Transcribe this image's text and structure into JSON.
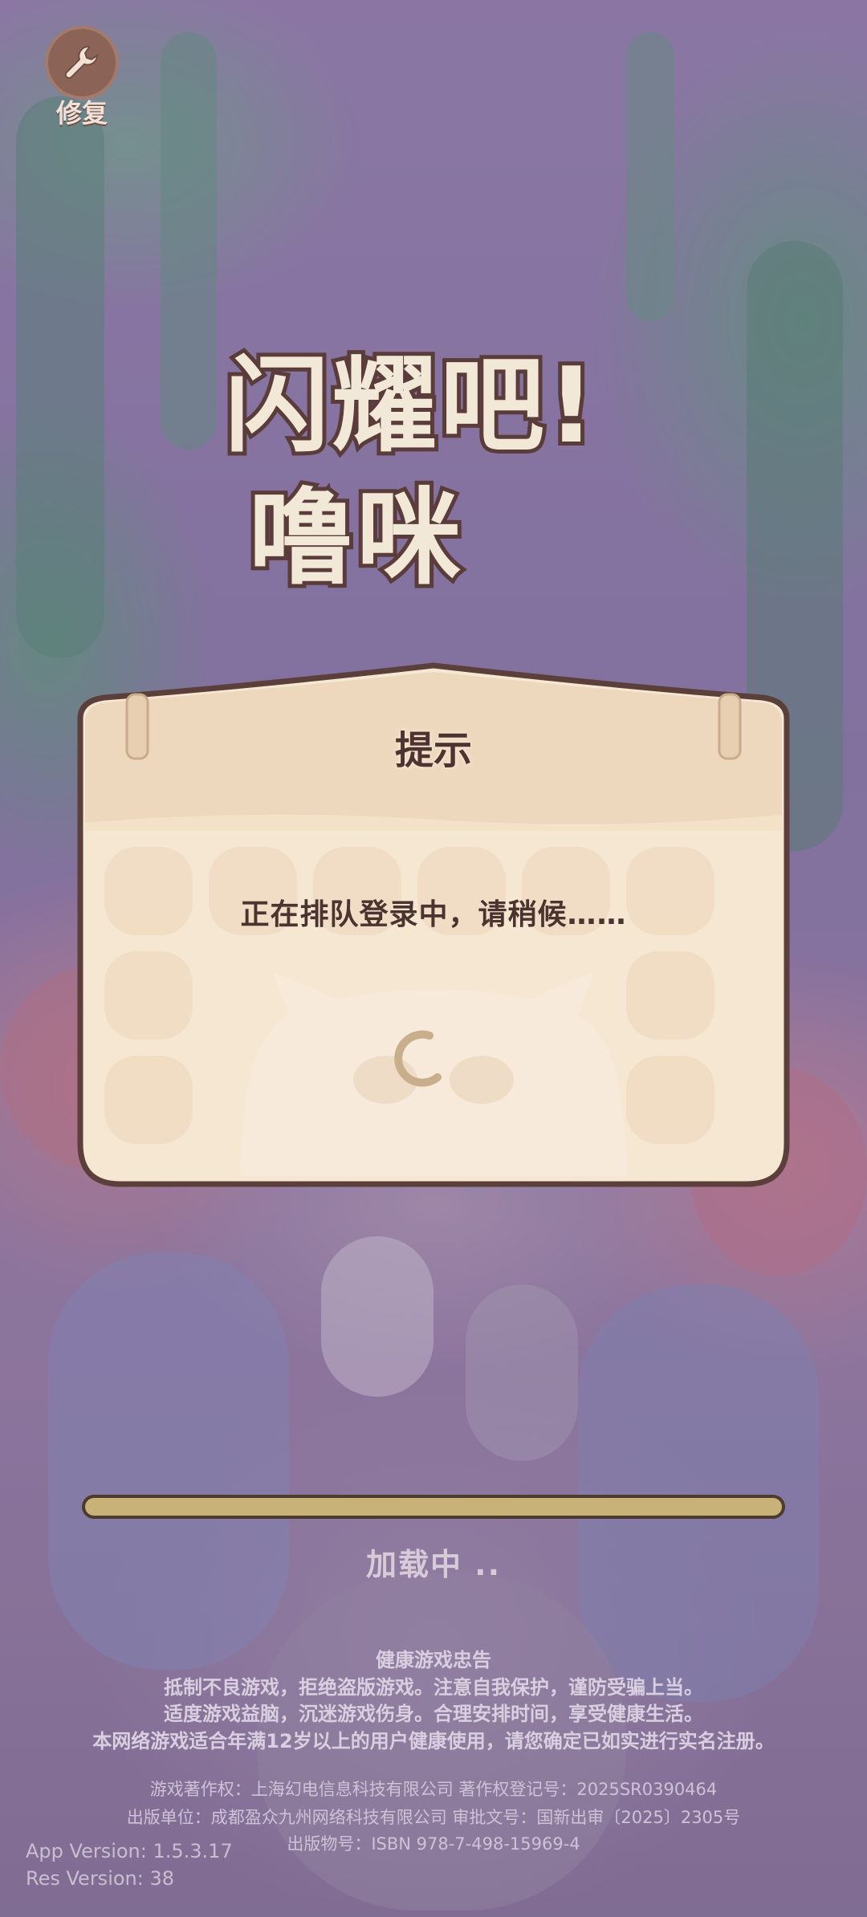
{
  "repair": {
    "label": "修复",
    "icon": "wrench-icon"
  },
  "logo": {
    "line1": "闪耀吧!",
    "line2": "噜咪"
  },
  "dialog": {
    "title": "提示",
    "message": "正在排队登录中，请稍候……"
  },
  "loading": {
    "text": "加载中 ..",
    "progress": 1.0
  },
  "notice": {
    "title": "健康游戏忠告",
    "line1": "抵制不良游戏，拒绝盗版游戏。注意自我保护，谨防受骗上当。",
    "line2": "适度游戏益脑，沉迷游戏伤身。合理安排时间，享受健康生活。",
    "line3": "本网络游戏适合年满12岁以上的用户健康使用，请您确定已如实进行实名注册。"
  },
  "copyright": {
    "line1": "游戏著作权：上海幻电信息科技有限公司 著作权登记号：2025SR0390464",
    "line2": "出版单位：成都盈众九州网络科技有限公司 审批文号：国新出审〔2025〕2305号",
    "line3": "出版物号：ISBN 978-7-498-15969-4"
  },
  "version": {
    "app": "App Version: 1.5.3.17",
    "res": "Res Version: 38"
  },
  "colors": {
    "dialog_bg": "#f6e6d0",
    "dialog_border": "#5b3f3a",
    "bar_fill": "#c8b277"
  }
}
